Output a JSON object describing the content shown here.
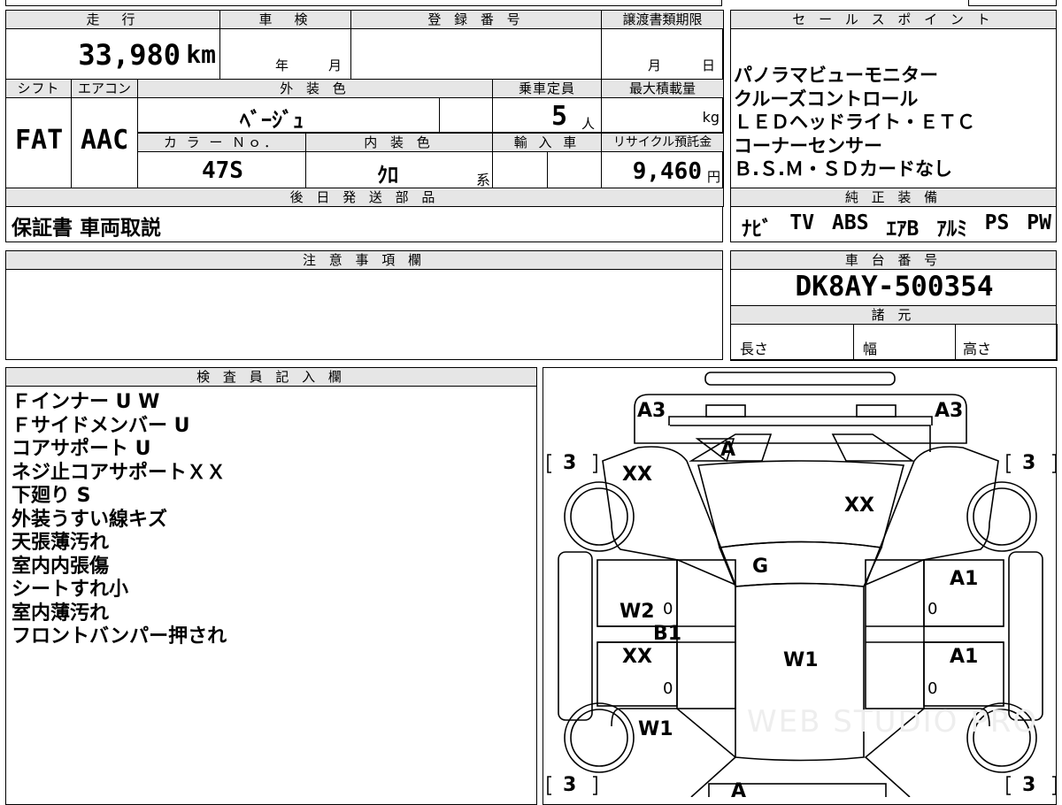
{
  "main_table": {
    "mileage_header": "走　行",
    "mileage_value": "33,980",
    "mileage_unit": "km",
    "inspection_header": "車　検",
    "inspection_year": "年",
    "inspection_month": "月",
    "registration_header": "登 録 番 号",
    "registration_value": "",
    "transfer_header": "譲渡書類期限",
    "transfer_month": "月",
    "transfer_day": "日",
    "shift_header": "シフト",
    "shift_value": "FAT",
    "ac_header": "エアコン",
    "ac_value": "AAC",
    "exterior_header": "外 装 色",
    "exterior_value": "ﾍﾞｰｼﾞｭ",
    "capacity_header": "乗車定員",
    "capacity_value": "5",
    "capacity_unit": "人",
    "load_header": "最大積載量",
    "load_unit": "kg",
    "color_no_header": "カ ラ ー Ｎｏ．",
    "color_no_value": "47S",
    "interior_header": "内 装 色",
    "interior_value": "ｸﾛ",
    "interior_suffix": "系",
    "import_header": "輸 入 車",
    "recycle_header": "リサイクル預託金",
    "recycle_value": "9,460",
    "recycle_unit": "円",
    "later_parts_header": "後 日 発 送 部 品",
    "later_parts_value": "保証書 車両取説"
  },
  "sales_points": {
    "header": "セ ー ル ス ポ イ ン ト",
    "lines": [
      "パノラマビューモニター",
      "クルーズコントロール",
      "ＬＥＤヘッドライト・ＥＴＣ",
      "コーナーセンサー",
      "Ｂ.Ｓ.Ｍ・ＳＤカードなし"
    ]
  },
  "genuine_equipment": {
    "header": "純 正 装 備",
    "items": [
      "ﾅﾋﾞ",
      "TV",
      "ABS",
      "ｴｱB",
      "ｱﾙﾐ",
      "PS",
      "PW"
    ]
  },
  "notes": {
    "header": "注 意 事 項 欄",
    "value": ""
  },
  "chassis": {
    "header": "車 台 番 号",
    "value": "DK8AY-500354"
  },
  "specs": {
    "header": "諸 元",
    "length_label": "長さ",
    "width_label": "幅",
    "height_label": "高さ"
  },
  "inspector": {
    "header": "検 査 員 記 入 欄",
    "lines": [
      "Ｆインナー U W",
      "Ｆサイドメンバー U",
      "コアサポート U",
      "ネジ止コアサポートＸＸ",
      "下廻り S",
      "外装うすい線キズ",
      "天張薄汚れ",
      "室内内張傷",
      "シートすれ小",
      "室内薄汚れ",
      "フロントバンパー押され"
    ]
  },
  "diagram": {
    "marks": {
      "front_left_corner": "A3",
      "front_right_corner": "A3",
      "hood_front": "A",
      "left_front_fender": "XX",
      "hood": "XX",
      "windshield": "G",
      "left_front_door": "W2",
      "right_front_door": "A1",
      "left_pillar": "B1",
      "left_rear_door": "XX",
      "roof": "W1",
      "right_rear_door": "A1",
      "left_rear_fender": "W1",
      "rear_bumper": "A"
    },
    "tire_left_front": "3",
    "tire_right_front": "3",
    "tire_left_rear": "3",
    "tire_right_rear": "3",
    "door_zero": "0",
    "watermark": "WEB STUDIO PRO"
  }
}
